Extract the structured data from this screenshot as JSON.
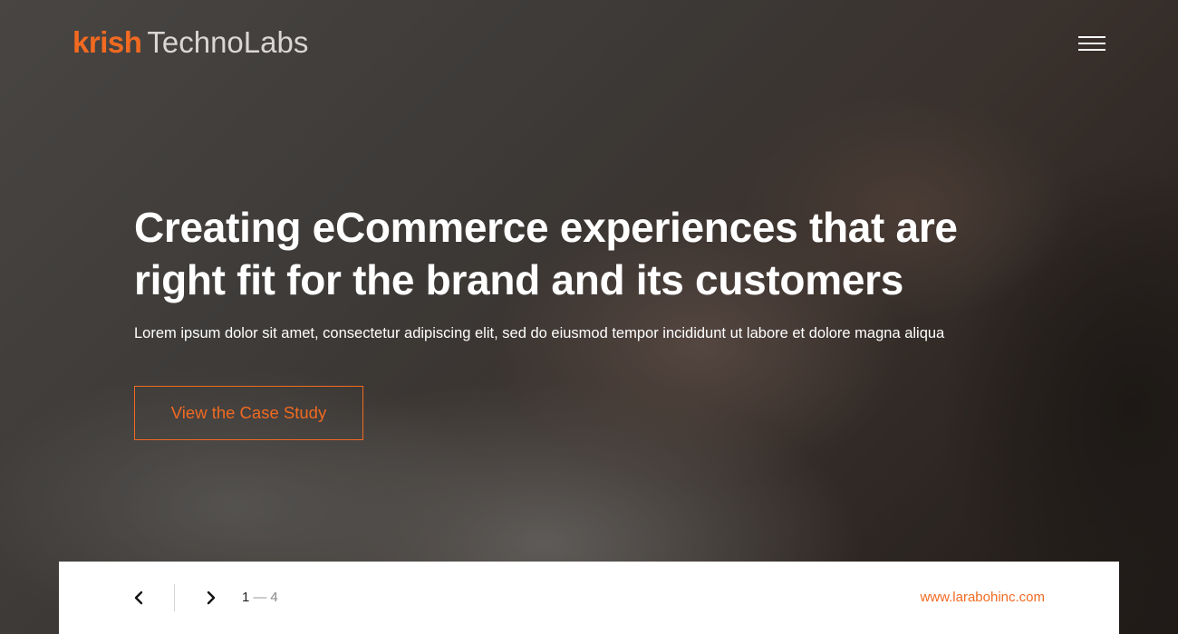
{
  "brand": {
    "logo_part1": "krish",
    "logo_part2": "TechnoLabs",
    "accent_color": "#f26a21"
  },
  "header": {
    "menu_icon": "hamburger-menu-icon"
  },
  "hero": {
    "headline_line1": "Creating eCommerce experiences that are",
    "headline_line2": "right fit for the brand and its customers",
    "subtext": "Lorem ipsum dolor sit amet, consectetur adipiscing elit, sed do eiusmod tempor incididunt ut labore et dolore magna aliqua",
    "cta_label": "View the Case Study"
  },
  "slider": {
    "prev_icon": "chevron-left-icon",
    "next_icon": "chevron-right-icon",
    "current": "1",
    "separator": "—",
    "total": "4",
    "site_link": "www.larabohinc.com"
  }
}
